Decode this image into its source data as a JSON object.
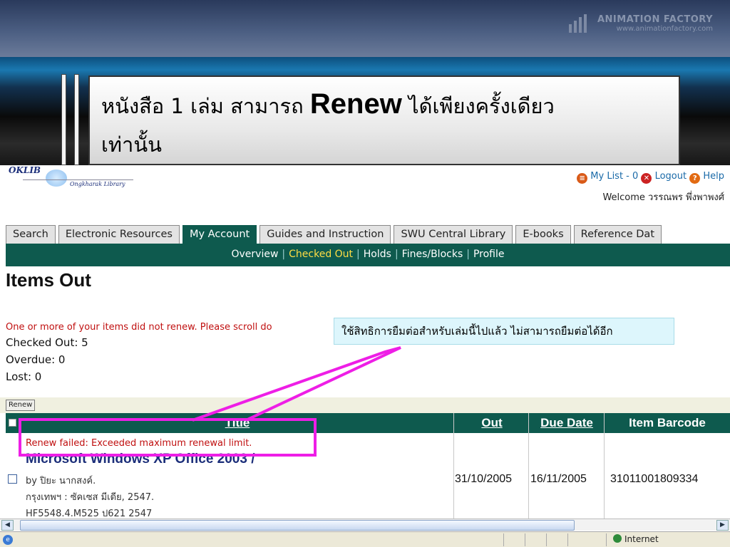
{
  "slide": {
    "logo_main": "ANIMATION FACTORY",
    "logo_sub": "www.animationfactory.com",
    "title_part1": "หนังสือ 1 เล่ม สามารถ ",
    "title_bold": "Renew",
    "title_part2": " ได้เพียงครั้งเดียว",
    "title_line2": "เท่านั้น"
  },
  "library": {
    "logo_text": "OKLIB",
    "logo_sub": "Ongkharak Library",
    "my_list": "My List - 0",
    "logout": "Logout",
    "help": "Help",
    "welcome": "Welcome วรรณพร พึ่งพาพงศ์"
  },
  "tabs": [
    "Search",
    "Electronic Resources",
    "My Account",
    "Guides and Instruction",
    "SWU Central Library",
    "E-books",
    "Reference Dat"
  ],
  "subnav": [
    "Overview",
    "Checked Out",
    "Holds",
    "Fines/Blocks",
    "Profile"
  ],
  "page": {
    "heading": "Items Out",
    "warning": "One or more of your items did not renew. Please scroll do",
    "checked_out": "Checked Out: 5",
    "overdue": "Overdue: 0",
    "lost": "Lost: 0",
    "callout": "ใช้สิทธิการยืมต่อสำหรับเล่มนี้ไปแล้ว ไม่สามารถยืมต่อได้อีก",
    "renew_button": "Renew"
  },
  "table": {
    "headers": {
      "title": "Title",
      "out": "Out",
      "due_date": "Due Date",
      "item_barcode": "Item Barcode"
    },
    "row": {
      "fail_message": "Renew failed: Exceeded maximum renewal limit.",
      "title": "Microsoft Windows XP Office 2003 /",
      "author": "by ปิยะ นากสงค์.",
      "publisher": "กรุงเทพฯ : ซัคเซส มีเดีย, 2547.",
      "call_number": "HF5548.4.M525 ป621 2547",
      "out": "31/10/2005",
      "due": "16/11/2005",
      "barcode": "31011001809334"
    }
  },
  "statusbar": {
    "zone": "Internet"
  },
  "colors": {
    "nav_green": "#0e5a4e",
    "highlight_magenta": "#ee1ee6",
    "error_red": "#c01010",
    "callout_bg": "#ddf6fc"
  }
}
